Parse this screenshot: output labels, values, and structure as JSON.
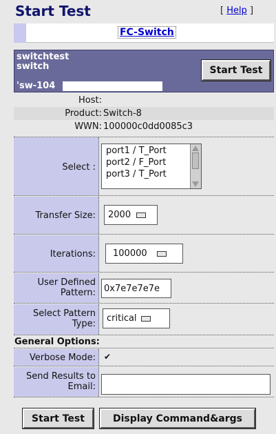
{
  "header": {
    "title": "Start Test",
    "help_prefix": "[ ",
    "help_label": "Help",
    "help_suffix": " ]"
  },
  "tab": {
    "label": "FC-Switch"
  },
  "switch": {
    "line1": "switchtest",
    "line2": "switch",
    "line3": "'sw-104",
    "start_button": "Start Test"
  },
  "info": {
    "host_label": "Host:",
    "host_value": "",
    "product_label": "Product:",
    "product_value": "Switch-8",
    "wwn_label": "WWN:",
    "wwn_value": "100000c0dd0085c3"
  },
  "form": {
    "select_label": "Select :",
    "ports": [
      "port1 / T_Port",
      "port2 / F_Port",
      "port3 / T_Port"
    ],
    "transfer_label": "Transfer Size:",
    "transfer_value": "2000",
    "iterations_label": "Iterations:",
    "iterations_value": "100000",
    "pattern_label_1": "User Defined",
    "pattern_label_2": "Pattern:",
    "pattern_value": "0x7e7e7e7e",
    "ptype_label_1": "Select Pattern",
    "ptype_label_2": "Type:",
    "ptype_value": "critical"
  },
  "general": {
    "section_title": "General Options:",
    "verbose_label": "Verbose Mode:",
    "verbose_checked": "✔",
    "email_label_1": "Send Results to",
    "email_label_2": "Email:",
    "email_value": ""
  },
  "footer": {
    "start_button": "Start Test",
    "display_button": "Display Command&args"
  }
}
